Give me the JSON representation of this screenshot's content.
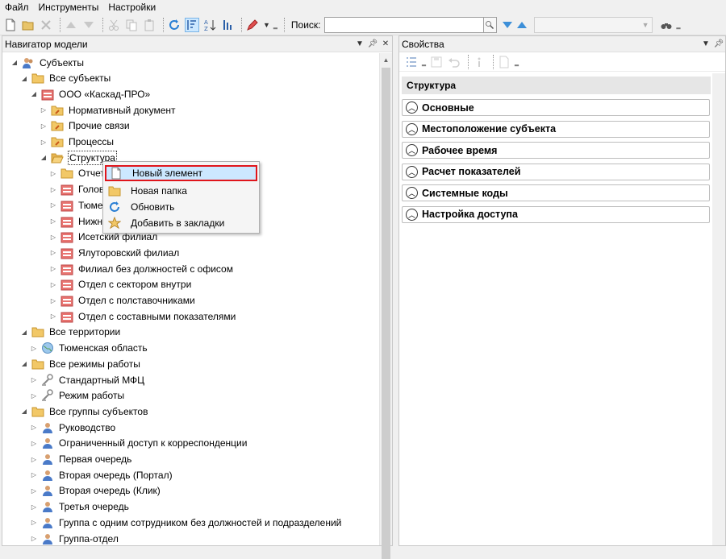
{
  "menubar": {
    "items": [
      "Файл",
      "Инструменты",
      "Настройки"
    ]
  },
  "toolbar": {
    "search_label": "Поиск:",
    "search_value": ""
  },
  "left_panel": {
    "title": "Навигатор модели"
  },
  "right_panel": {
    "title": "Свойства",
    "group_header": "Структура"
  },
  "tree": [
    {
      "label": "Субъекты",
      "icon": "people-icon"
    },
    {
      "label": "Все субъекты",
      "icon": "folder-icon"
    },
    {
      "label": "ООО «Каскад-ПРО»",
      "icon": "building-icon"
    },
    {
      "label": "Нормативный документ",
      "icon": "folder-link-icon"
    },
    {
      "label": "Прочие связи",
      "icon": "folder-link-icon"
    },
    {
      "label": "Процессы",
      "icon": "folder-link-icon"
    },
    {
      "label": "Структура",
      "icon": "folder-open-icon"
    },
    {
      "label": "Отчеты",
      "icon": "folder-icon"
    },
    {
      "label": "Головн",
      "icon": "building-icon"
    },
    {
      "label": "Тюмен",
      "icon": "building-icon"
    },
    {
      "label": "Нижне",
      "icon": "building-icon"
    },
    {
      "label": "Исетский филиал",
      "icon": "building-icon"
    },
    {
      "label": "Ялуторовский филиал",
      "icon": "building-icon"
    },
    {
      "label": "Филиал без должностей с офисом",
      "icon": "building-icon"
    },
    {
      "label": "Отдел с сектором внутри",
      "icon": "building-icon"
    },
    {
      "label": "Отдел с полставочниками",
      "icon": "building-icon"
    },
    {
      "label": "Отдел с составными показателями",
      "icon": "building-icon"
    },
    {
      "label": "Все территории",
      "icon": "folder-icon"
    },
    {
      "label": "Тюменская область",
      "icon": "globe-icon"
    },
    {
      "label": "Все режимы работы",
      "icon": "folder-icon"
    },
    {
      "label": "Стандартный МФЦ",
      "icon": "tools-icon"
    },
    {
      "label": "Режим работы",
      "icon": "tools-icon"
    },
    {
      "label": "Все группы субъектов",
      "icon": "folder-icon"
    },
    {
      "label": "Руководство",
      "icon": "person-icon"
    },
    {
      "label": "Ограниченный доступ к корреспонденции",
      "icon": "person-icon"
    },
    {
      "label": "Первая очередь",
      "icon": "person-icon"
    },
    {
      "label": "Вторая очередь (Портал)",
      "icon": "person-icon"
    },
    {
      "label": "Вторая очередь (Клик)",
      "icon": "person-icon"
    },
    {
      "label": "Третья очередь",
      "icon": "person-icon"
    },
    {
      "label": "Группа с одним сотрудником без должностей и подразделений",
      "icon": "person-icon"
    },
    {
      "label": "Группа-отдел",
      "icon": "person-icon"
    }
  ],
  "context_menu": {
    "items": [
      {
        "label": "Новый элемент",
        "icon": "new-document-icon"
      },
      {
        "label": "Новая папка",
        "icon": "folder-icon"
      },
      {
        "label": "Обновить",
        "icon": "refresh-icon"
      },
      {
        "label": "Добавить в закладки",
        "icon": "bookmark-star-icon"
      }
    ]
  },
  "sections": [
    "Основные",
    "Местоположение субъекта",
    "Рабочее время",
    "Расчет показателей",
    "Системные коды",
    "Настройка доступа"
  ],
  "colors": {
    "highlight": "#cce8ff",
    "highlight_border": "#e0151b"
  }
}
